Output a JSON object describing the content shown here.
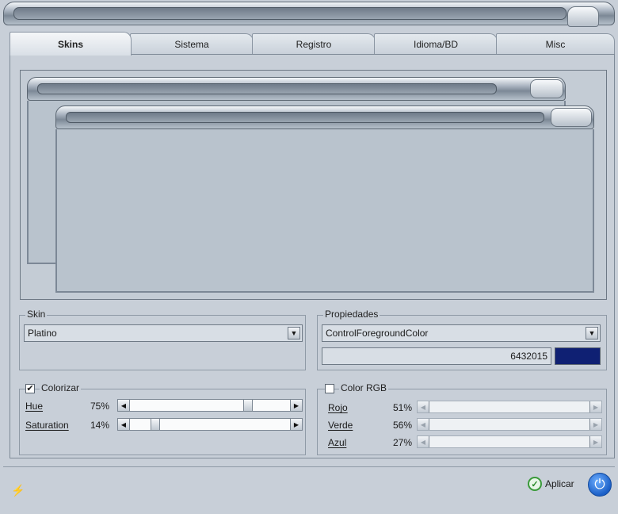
{
  "tabs": [
    {
      "label": "Skins",
      "active": true
    },
    {
      "label": "Sistema",
      "active": false
    },
    {
      "label": "Registro",
      "active": false
    },
    {
      "label": "Idioma/BD",
      "active": false
    },
    {
      "label": "Misc",
      "active": false
    }
  ],
  "skin_group": {
    "label": "Skin",
    "selected": "Platino"
  },
  "properties_group": {
    "label": "Propiedades",
    "selected": "ControlForegroundColor",
    "value": "6432015",
    "color": "#0f2073"
  },
  "colorize": {
    "label": "Colorizar",
    "checked": true,
    "rows": [
      {
        "label": "Hue",
        "percent": "75",
        "unit": "%",
        "level": 0.75
      },
      {
        "label": "Saturation",
        "percent": "14",
        "unit": "%",
        "level": 0.14
      }
    ]
  },
  "color_rgb": {
    "label": "Color RGB",
    "checked": false,
    "rows": [
      {
        "label": "Rojo",
        "percent": "51",
        "unit": "%",
        "level": 0.51
      },
      {
        "label": "Verde",
        "percent": "56",
        "unit": "%",
        "level": 0.56
      },
      {
        "label": "Azul",
        "percent": "27",
        "unit": "%",
        "level": 0.27
      }
    ]
  },
  "footer": {
    "apply_label": "Aplicar"
  },
  "icons": {
    "apply": "check-circle-icon",
    "power": "power-icon",
    "plug": "plug-icon",
    "window_button": "window-button-icon"
  }
}
